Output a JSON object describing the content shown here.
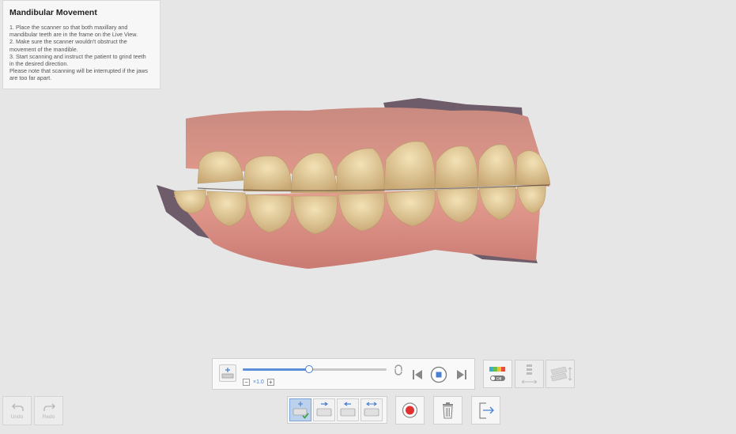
{
  "info_panel": {
    "title": "Mandibular Movement",
    "lines": [
      "1. Place the scanner so that both maxillary and",
      "mandibular teeth are in the frame on the Live View.",
      "2. Make sure the scanner wouldn't obstruct the",
      "movement of the mandible.",
      "3. Start scanning and instruct the patient to grind teeth",
      "in the desired direction.",
      "Please note that scanning will be interrupted if the jaws",
      "are too far apart."
    ]
  },
  "playback": {
    "progress": 0.46,
    "speed_label": "×1.0",
    "minus": "−",
    "plus": "+"
  },
  "tools": {
    "color_toggle_label": "Off"
  },
  "bottom": {
    "undo_label": "Undo",
    "redo_label": "Redo"
  },
  "colors": {
    "accent": "#4a7fd0",
    "record": "#e03030",
    "stop": "#4a7fd0",
    "gum": "#d9837a",
    "tooth": "#e7cf9f"
  }
}
